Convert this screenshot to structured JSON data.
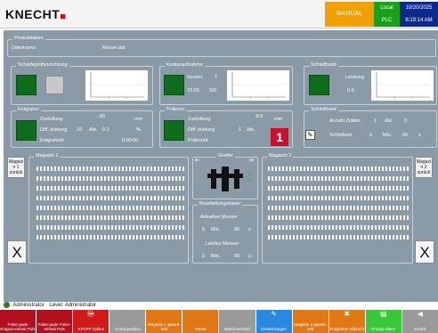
{
  "header": {
    "logo": "KNECHT",
    "mode": "MANUAL",
    "local": "Local",
    "plc": "PLC",
    "date": "10/20/2025",
    "time": "8:19:14 AM"
  },
  "produktdaten": {
    "title": "Produktdaten",
    "dateiname_label": "Dateiname:",
    "dateiname_value": "Messe.dat"
  },
  "schaerfvorrichtung": {
    "title": "Schärfeprüfvorrichtung"
  },
  "konturaufnahme": {
    "title": "Konturaufnahme",
    "sensor_label": "Sensor",
    "sensor_value": "T",
    "val1": "73.05",
    "val2": "S/0"
  },
  "schleifband1": {
    "title": "Schleifband",
    "leistung_label": "Leistung",
    "leistung_value": "0.0"
  },
  "entgraten": {
    "title": "Entgraten",
    "zustellung_label": "Zustellung",
    "zustellung_value": "-20",
    "zustellung_unit": "mm",
    "diff_label": "Diff. leistung",
    "diff_value": "10",
    "akt_label": "Akt.",
    "akt_value": "0.0",
    "pct": "%",
    "entgratzeit_label": "Entgratzeit",
    "entgratzeit_value": "0:00:00"
  },
  "polieren": {
    "title": "Polieren",
    "zustellung_label": "Zustellung",
    "zustellung_value": "-6.5",
    "zustellung_unit": "mm",
    "diff_label": "Diff. leistung",
    "diff_value": "1",
    "akt_label": "Akt.",
    "polierzeit_label": "Polierzeit"
  },
  "schleifband2": {
    "title": "Schleifband",
    "zyklen_label": "Anzahl Zyklen",
    "zyklen_value": "1",
    "akt_label": "Akt.",
    "akt_value": "0",
    "schleifzeit_label": "Schleifzeit",
    "schleifzeit_value": "0",
    "min_label": "Min.",
    "sec_value": "00",
    "sec_label": "s"
  },
  "callout": "1",
  "magazin1": {
    "title": "Magazin 1",
    "back_label": "Magazi n 1 zurück",
    "x_label": "X"
  },
  "magazin2": {
    "title": "Magazin 2",
    "back_label": "Magazi n 2 zurück",
    "x_label": "X"
  },
  "greifer": {
    "title": "Greifer",
    "left_arrow": "⇤",
    "right_arrow": "⇥"
  },
  "bearbeitung": {
    "title": "Bearbeitungsdauer",
    "aktuell_label": "Aktuelles Messer",
    "aktuell_min": "0",
    "min_label": "Min.",
    "aktuell_sec": "00",
    "sec_label": "s",
    "letztes_label": "Letztes Messer",
    "letztes_min": "0",
    "letztes_sec": "00"
  },
  "status": {
    "user": "Administrator",
    "level_label": "Level: Administrator"
  },
  "toolbar": [
    {
      "label": "Polier-pade Entgrat-einheit Puls",
      "color": "#b01020"
    },
    {
      "label": "Polier-pade Polier-einheit Puls",
      "color": "#b01020"
    },
    {
      "label": "STOPP Zyklus",
      "color": "#d01a1a",
      "icon": "⛔"
    },
    {
      "label": "Grund-position",
      "color": "#9a9a9a"
    },
    {
      "label": "Magazin 1 geweh-selt",
      "color": "#e07818"
    },
    {
      "label": "Reset",
      "color": "#e07818"
    },
    {
      "label": "Band-wechsel",
      "color": "#9a9a9a"
    },
    {
      "label": "Einstel-lungen",
      "color": "#2a88e0",
      "icon": "✎"
    },
    {
      "label": "Magazin 2 geweh-selt",
      "color": "#e07818"
    },
    {
      "label": "Programm Abbruch",
      "color": "#e07818",
      "icon": "✖"
    },
    {
      "label": "Produk-daten",
      "color": "#3ac83a",
      "icon": "▤"
    },
    {
      "label": "Zurück",
      "color": "#9a9a9a",
      "icon": "◀"
    }
  ],
  "colors": {
    "panel": "#8a9aa6",
    "lamp_green": "#0e6e1e",
    "accent_red": "#c8102e"
  }
}
